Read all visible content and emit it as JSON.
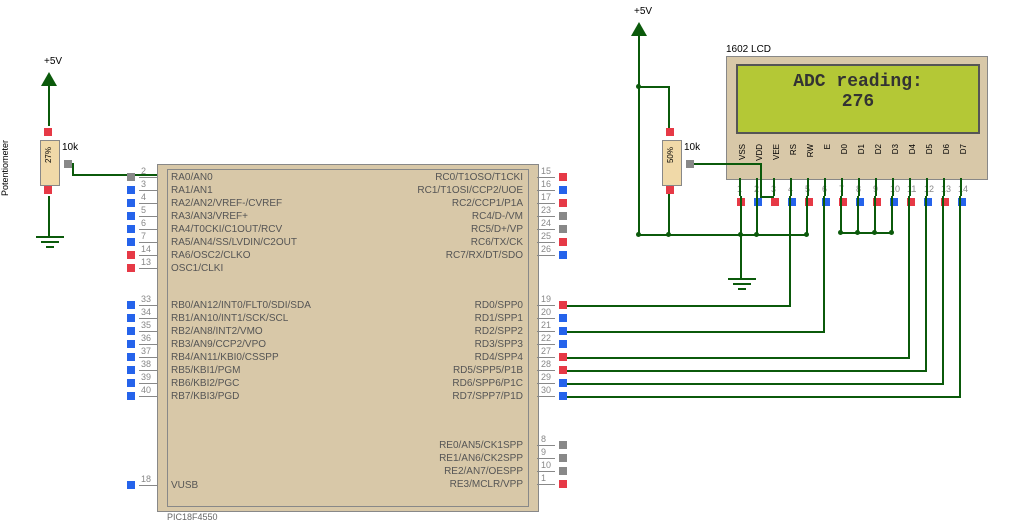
{
  "power_label": "+5V",
  "potentiometer": {
    "caption": "Potentiometer",
    "resistance": "10k",
    "reading": "27%"
  },
  "mcu": {
    "name": "PIC18F4550",
    "left_pins": [
      {
        "num": "2",
        "name": "RA0/AN0"
      },
      {
        "num": "3",
        "name": "RA1/AN1"
      },
      {
        "num": "4",
        "name": "RA2/AN2/VREF-/CVREF"
      },
      {
        "num": "5",
        "name": "RA3/AN3/VREF+"
      },
      {
        "num": "6",
        "name": "RA4/T0CKI/C1OUT/RCV"
      },
      {
        "num": "7",
        "name": "RA5/AN4/SS/LVDIN/C2OUT"
      },
      {
        "num": "14",
        "name": "RA6/OSC2/CLKO"
      },
      {
        "num": "13",
        "name": "OSC1/CLKI"
      }
    ],
    "left_pins_b": [
      {
        "num": "33",
        "name": "RB0/AN12/INT0/FLT0/SDI/SDA"
      },
      {
        "num": "34",
        "name": "RB1/AN10/INT1/SCK/SCL"
      },
      {
        "num": "35",
        "name": "RB2/AN8/INT2/VMO"
      },
      {
        "num": "36",
        "name": "RB3/AN9/CCP2/VPO"
      },
      {
        "num": "37",
        "name": "RB4/AN11/KBI0/CSSPP"
      },
      {
        "num": "38",
        "name": "RB5/KBI1/PGM"
      },
      {
        "num": "39",
        "name": "RB6/KBI2/PGC"
      },
      {
        "num": "40",
        "name": "RB7/KBI3/PGD"
      }
    ],
    "vusb": {
      "num": "18",
      "name": "VUSB"
    },
    "right_pins_c": [
      {
        "num": "15",
        "name": "RC0/T1OSO/T1CKI"
      },
      {
        "num": "16",
        "name": "RC1/T1OSI/CCP2/UOE"
      },
      {
        "num": "17",
        "name": "RC2/CCP1/P1A"
      },
      {
        "num": "23",
        "name": "RC4/D-/VM"
      },
      {
        "num": "24",
        "name": "RC5/D+/VP"
      },
      {
        "num": "25",
        "name": "RC6/TX/CK"
      },
      {
        "num": "26",
        "name": "RC7/RX/DT/SDO"
      }
    ],
    "right_pins_d": [
      {
        "num": "19",
        "name": "RD0/SPP0"
      },
      {
        "num": "20",
        "name": "RD1/SPP1"
      },
      {
        "num": "21",
        "name": "RD2/SPP2"
      },
      {
        "num": "22",
        "name": "RD3/SPP3"
      },
      {
        "num": "27",
        "name": "RD4/SPP4"
      },
      {
        "num": "28",
        "name": "RD5/SPP5/P1B"
      },
      {
        "num": "29",
        "name": "RD6/SPP6/P1C"
      },
      {
        "num": "30",
        "name": "RD7/SPP7/P1D"
      }
    ],
    "right_pins_e": [
      {
        "num": "8",
        "name": "RE0/AN5/CK1SPP"
      },
      {
        "num": "9",
        "name": "RE1/AN6/CK2SPP"
      },
      {
        "num": "10",
        "name": "RE2/AN7/OESPP"
      },
      {
        "num": "1",
        "name": "RE3/MCLR/VPP"
      }
    ]
  },
  "lcd": {
    "caption": "1602 LCD",
    "line1": "ADC reading:",
    "line2": "276",
    "pins": [
      "VSS",
      "VDD",
      "VEE",
      "RS",
      "RW",
      "E",
      "D0",
      "D1",
      "D2",
      "D3",
      "D4",
      "D5",
      "D6",
      "D7"
    ],
    "nums": [
      "1",
      "2",
      "3",
      "4",
      "5",
      "6",
      "7",
      "8",
      "9",
      "10",
      "11",
      "12",
      "13",
      "14"
    ]
  },
  "pot2": {
    "resistance": "10k",
    "reading": "50%"
  }
}
